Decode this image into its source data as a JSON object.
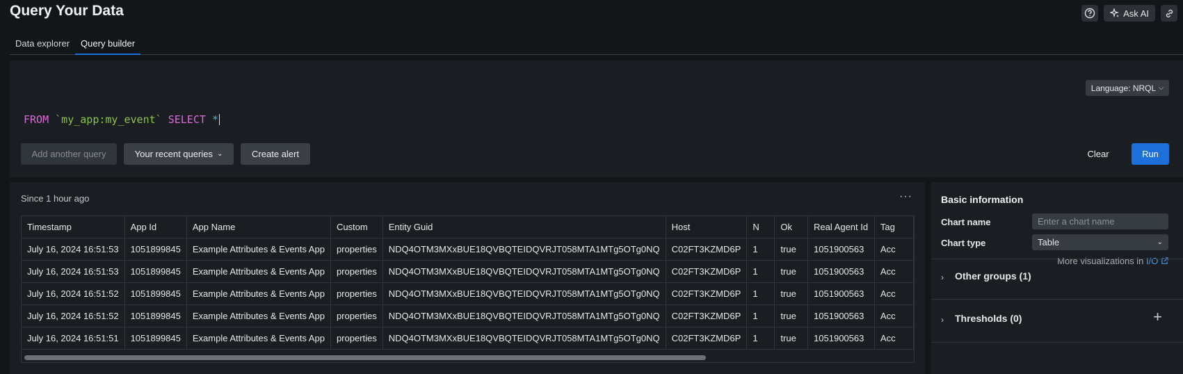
{
  "header": {
    "title": "Query Your Data",
    "help_icon": "help-circle-icon",
    "ask_ai_label": "Ask AI",
    "link_icon": "link-icon"
  },
  "tabs": [
    {
      "label": "Data explorer",
      "active": false
    },
    {
      "label": "Query builder",
      "active": true
    }
  ],
  "editor": {
    "language_label": "Language: NRQL",
    "query": {
      "from_kw": "FROM",
      "table": "`my_app:my_event`",
      "select_kw": "SELECT",
      "star": "*"
    },
    "buttons": {
      "add_query": "Add another query",
      "recent_queries": "Your recent queries",
      "create_alert": "Create alert",
      "clear": "Clear",
      "run": "Run"
    }
  },
  "results": {
    "since": "Since 1 hour ago",
    "columns": [
      "Timestamp",
      "App Id",
      "App Name",
      "Custom",
      "Entity Guid",
      "Host",
      "N",
      "Ok",
      "Real Agent Id",
      "Tag"
    ],
    "rows": [
      [
        "July 16, 2024 16:51:53",
        "1051899845",
        "Example Attributes & Events App",
        "properties",
        "NDQ4OTM3MXxBUE18QVBQTEIDQVRJT058MTA1MTg5OTg0NQ",
        "C02FT3KZMD6P",
        "1",
        "true",
        "1051900563",
        "Acc"
      ],
      [
        "July 16, 2024 16:51:53",
        "1051899845",
        "Example Attributes & Events App",
        "properties",
        "NDQ4OTM3MXxBUE18QVBQTEIDQVRJT058MTA1MTg5OTg0NQ",
        "C02FT3KZMD6P",
        "1",
        "true",
        "1051900563",
        "Acc"
      ],
      [
        "July 16, 2024 16:51:52",
        "1051899845",
        "Example Attributes & Events App",
        "properties",
        "NDQ4OTM3MXxBUE18QVBQTEIDQVRJT058MTA1MTg5OTg0NQ",
        "C02FT3KZMD6P",
        "1",
        "true",
        "1051900563",
        "Acc"
      ],
      [
        "July 16, 2024 16:51:52",
        "1051899845",
        "Example Attributes & Events App",
        "properties",
        "NDQ4OTM3MXxBUE18QVBQTEIDQVRJT058MTA1MTg5OTg0NQ",
        "C02FT3KZMD6P",
        "1",
        "true",
        "1051900563",
        "Acc"
      ],
      [
        "July 16, 2024 16:51:51",
        "1051899845",
        "Example Attributes & Events App",
        "properties",
        "NDQ4OTM3MXxBUE18QVBQTEIDQVRJT058MTA1MTg5OTg0NQ",
        "C02FT3KZMD6P",
        "1",
        "true",
        "1051900563",
        "Acc"
      ]
    ]
  },
  "side": {
    "title": "Basic information",
    "chart_name_label": "Chart name",
    "chart_name_placeholder": "Enter a chart name",
    "chart_type_label": "Chart type",
    "chart_type_value": "Table",
    "more_text": "More visualizations in ",
    "more_link": "I/O",
    "other_groups": "Other groups (1)",
    "thresholds": "Thresholds (0)"
  },
  "colors": {
    "accent": "#1d6fd9",
    "keyword": "#d96cd8",
    "table_name": "#8bc34a"
  }
}
